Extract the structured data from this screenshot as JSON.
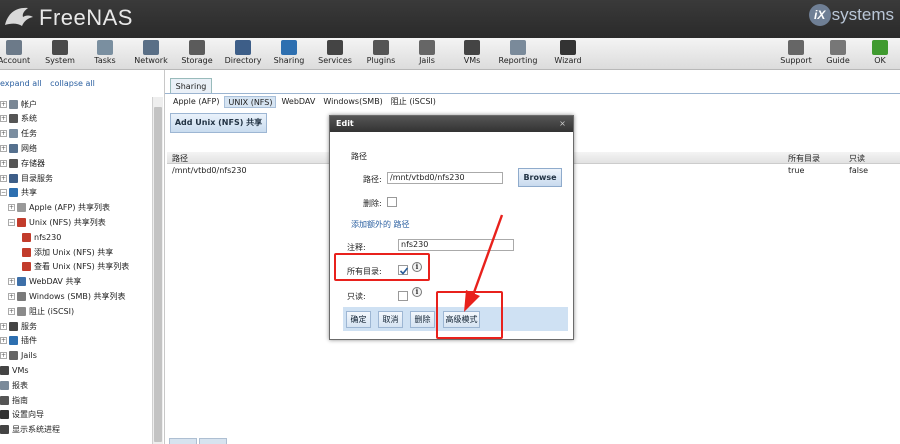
{
  "brand": {
    "name": "FreeNAS",
    "vendor_mark": "iX",
    "vendor_text": "systems"
  },
  "toolbar": [
    {
      "label": "Account",
      "icon": "account-icon",
      "color": "#6c7a89"
    },
    {
      "label": "System",
      "icon": "system-icon",
      "color": "#4a4a4a"
    },
    {
      "label": "Tasks",
      "icon": "tasks-icon",
      "color": "#7a8fa0"
    },
    {
      "label": "Network",
      "icon": "network-icon",
      "color": "#5a6f86"
    },
    {
      "label": "Storage",
      "icon": "storage-icon",
      "color": "#5b5b5b"
    },
    {
      "label": "Directory",
      "icon": "directory-icon",
      "color": "#3d5e88"
    },
    {
      "label": "Sharing",
      "icon": "sharing-icon",
      "color": "#2d6fb0"
    },
    {
      "label": "Services",
      "icon": "services-icon",
      "color": "#444444"
    },
    {
      "label": "Plugins",
      "icon": "plugins-icon",
      "color": "#555555"
    },
    {
      "label": "Jails",
      "icon": "jails-icon",
      "color": "#666666"
    },
    {
      "label": "VMs",
      "icon": "vms-icon",
      "color": "#444444"
    },
    {
      "label": "Reporting",
      "icon": "reporting-icon",
      "color": "#7a8a9a"
    },
    {
      "label": "Wizard",
      "icon": "wizard-icon",
      "color": "#333333"
    },
    {
      "label": "Support",
      "icon": "support-icon",
      "color": "#666666"
    },
    {
      "label": "Guide",
      "icon": "guide-icon",
      "color": "#777777"
    },
    {
      "label": "OK",
      "icon": "ok-status-icon",
      "color": "#3f9a2f"
    }
  ],
  "sidebar": {
    "expand_all": "expand all",
    "collapse_all": "collapse all",
    "items": [
      {
        "label": "帐户",
        "icon": "account-icon",
        "color": "#7a8795",
        "pm": "+"
      },
      {
        "label": "系统",
        "icon": "system-icon",
        "color": "#555555",
        "pm": "+"
      },
      {
        "label": "任务",
        "icon": "tasks-icon",
        "color": "#7b8ea0",
        "pm": "+"
      },
      {
        "label": "网络",
        "icon": "network-icon",
        "color": "#55708e",
        "pm": "+"
      },
      {
        "label": "存储器",
        "icon": "storage-icon",
        "color": "#555555",
        "pm": "+"
      },
      {
        "label": "目录服务",
        "icon": "directory-icon",
        "color": "#3d5e88",
        "pm": "+"
      },
      {
        "label": "共享",
        "icon": "sharing-icon",
        "color": "#2d6fb0",
        "pm": "−"
      },
      {
        "label": "Apple (AFP) 共享列表",
        "icon": "apple-icon",
        "color": "#999999",
        "pm": "+"
      },
      {
        "label": "Unix (NFS) 共享列表",
        "icon": "nfs-icon",
        "color": "#c23b2b",
        "pm": "−"
      },
      {
        "label": "nfs230",
        "icon": "nfs-share-icon",
        "color": "#c23b2b",
        "pm": ""
      },
      {
        "label": "添加 Unix (NFS) 共享",
        "icon": "add-nfs-icon",
        "color": "#c23b2b",
        "pm": ""
      },
      {
        "label": "查看 Unix (NFS) 共享列表",
        "icon": "view-nfs-icon",
        "color": "#c23b2b",
        "pm": ""
      },
      {
        "label": "WebDAV 共享",
        "icon": "webdav-icon",
        "color": "#3d6fa8",
        "pm": "+"
      },
      {
        "label": "Windows (SMB) 共享列表",
        "icon": "windows-icon",
        "color": "#7a7a7a",
        "pm": "+"
      },
      {
        "label": "阻止 (iSCSI)",
        "icon": "iscsi-icon",
        "color": "#8a8a8a",
        "pm": "+"
      },
      {
        "label": "服务",
        "icon": "services-icon",
        "color": "#444444",
        "pm": "+"
      },
      {
        "label": "插件",
        "icon": "plugins-icon",
        "color": "#2d6fb0",
        "pm": "+"
      },
      {
        "label": "Jails",
        "icon": "jails-icon",
        "color": "#666666",
        "pm": "+"
      },
      {
        "label": "VMs",
        "icon": "vms-icon",
        "color": "#444444",
        "pm": ""
      },
      {
        "label": "报表",
        "icon": "reporting-icon",
        "color": "#7a8a9a",
        "pm": ""
      },
      {
        "label": "指南",
        "icon": "guide-icon",
        "color": "#555555",
        "pm": ""
      },
      {
        "label": "设置向导",
        "icon": "wizard-icon",
        "color": "#333333",
        "pm": ""
      },
      {
        "label": "显示系统进程",
        "icon": "process-icon",
        "color": "#444444",
        "pm": ""
      }
    ]
  },
  "main": {
    "tab": "Sharing",
    "subtabs": [
      "Apple (AFP)",
      "UNIX (NFS)",
      "WebDAV",
      "Windows(SMB)",
      "阻止 (iSCSI)"
    ],
    "active_subtab": 1,
    "add_button": "Add Unix (NFS) 共享",
    "grid": {
      "headers": [
        "路径",
        "所有目录",
        "只读"
      ],
      "row": [
        "/mnt/vtbd0/nfs230",
        "true",
        "false"
      ]
    }
  },
  "dialog": {
    "title": "Edit",
    "section_label": "路径",
    "path_label": "路径:",
    "path_value": "/mnt/vtbd0/nfs230",
    "browse": "Browse",
    "delete_label": "删除:",
    "add_extra": "添加额外的 路径",
    "comment_label": "注释:",
    "comment_value": "nfs230",
    "alldirs_label": "所有目录:",
    "readonly_label": "只读:",
    "buttons": {
      "ok": "确定",
      "cancel": "取消",
      "delete": "删除",
      "advanced": "高级模式"
    }
  },
  "annotation_color": "#e8211c"
}
